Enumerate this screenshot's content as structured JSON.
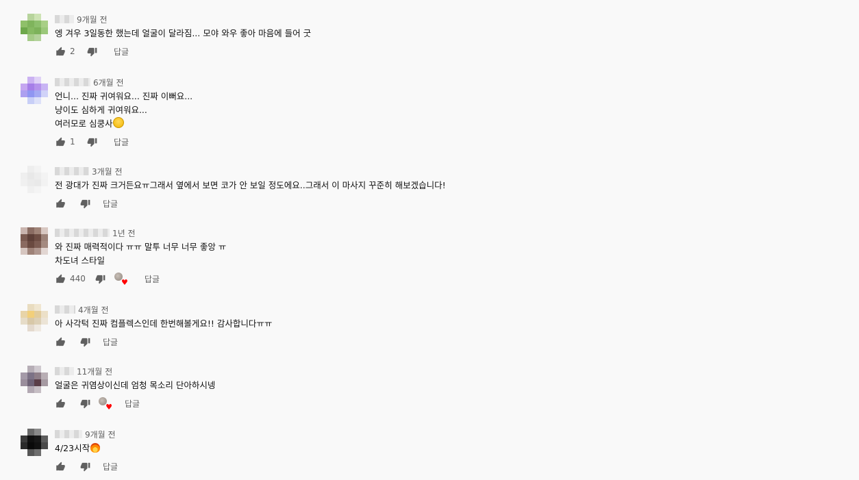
{
  "comments": [
    {
      "time": "9개월 전",
      "text": "엥 겨우 3일동한 했는데 얼굴이 달라짐... 모야 와우 좋아 마음에 들어 굿",
      "likes": "2",
      "reply": "답글",
      "avatar_colors": [
        "#f9f9f9",
        "#b7d49c",
        "#cde3b4",
        "#f9f9f9",
        "#8fc06a",
        "#7fb45c",
        "#8cbf6c",
        "#a8cf86",
        "#6ea84c",
        "#86ba62",
        "#7db25a",
        "#9bc87a",
        "#f9f9f9",
        "#a5cb87",
        "#b3d29a",
        "#f9f9f9"
      ]
    },
    {
      "time": "6개월 전",
      "text": "언니... 진짜 귀여워요... 진짜 이뻐요...\n냥이도 심하게 귀여워요...\n여러모로 심쿵사",
      "emoji": "smile-emoji",
      "likes": "1",
      "reply": "답글",
      "avatar_colors": [
        "#f9f9f9",
        "#cbb2f2",
        "#e0d2f7",
        "#f9f9f9",
        "#c5a6f0",
        "#a67ee8",
        "#b592ec",
        "#c8b4f4",
        "#ada0f0",
        "#8f96f2",
        "#a4a9f3",
        "#d0d2f8",
        "#f9f9f9",
        "#c8cff7",
        "#dde1f9",
        "#f9f9f9"
      ]
    },
    {
      "time": "3개월 전",
      "text": "전 광대가 진짜 크거든요ㅠ그래서 옆에서 보면 코가 안 보일 정도에요..그래서 이 마사지 꾸준히 해보겠습니다!",
      "likes": "",
      "reply": "답글",
      "avatar_colors": [
        "#f9f9f9",
        "#eeeeee",
        "#f3f3f3",
        "#f9f9f9",
        "#efefef",
        "#e8e8e8",
        "#ededed",
        "#f3f3f3",
        "#f0f0f0",
        "#ebebeb",
        "#e9e9e9",
        "#f2f2f2",
        "#f9f9f9",
        "#f0f0f0",
        "#f4f4f4",
        "#f9f9f9"
      ]
    },
    {
      "time": "1년 전",
      "text": "와 진짜 매력적이다 ㅠㅠ 말투 너무 너무 좋앙 ㅠ\n차도녀 스타일",
      "likes": "440",
      "hearted": true,
      "reply": "답글",
      "avatar_colors": [
        "#c9b4ae",
        "#8a6c62",
        "#a08478",
        "#d8c8c2",
        "#7a5a50",
        "#5e4038",
        "#6e4e44",
        "#9c8278",
        "#8a6a60",
        "#6a4a40",
        "#7c5c52",
        "#a48a80",
        "#d6c6c0",
        "#9e8278",
        "#b09890",
        "#e2d6d2"
      ]
    },
    {
      "time": "4개월 전",
      "text": "아 사각턱 진짜 컴플렉스인데 한번해볼게요!! 감사합니다ㅠㅠ",
      "likes": "",
      "reply": "답글",
      "avatar_colors": [
        "#f9f9f9",
        "#e9dcc0",
        "#f0e6d0",
        "#f9f9f9",
        "#e8d4a8",
        "#f2cf7a",
        "#e2cc9c",
        "#ece0c8",
        "#e6dcc8",
        "#d8c8a8",
        "#ddd0b6",
        "#ece4d6",
        "#f9f9f9",
        "#e4dace",
        "#efe9e0",
        "#f9f9f9"
      ]
    },
    {
      "time": "11개월 전",
      "text": "얼굴은 귀염상이신데 엄청 목소리 단아하시넹",
      "likes": "",
      "hearted": true,
      "reply": "답글",
      "avatar_colors": [
        "#f9f9f9",
        "#b6aeb6",
        "#cfc9cf",
        "#f9f9f9",
        "#a49aa8",
        "#7c7286",
        "#8e7e88",
        "#b8aeb4",
        "#9a8e9c",
        "#6e6276",
        "#5a3e48",
        "#a69aa2",
        "#f9f9f9",
        "#b2a8b2",
        "#c6bec4",
        "#f9f9f9"
      ]
    },
    {
      "time": "9개월 전",
      "text": "4/23시작",
      "emoji": "fire-emoji",
      "likes": "",
      "reply": "답글",
      "avatar_colors": [
        "#f9f9f9",
        "#6a6a6a",
        "#8a8a8a",
        "#f9f9f9",
        "#3a3a3a",
        "#101010",
        "#181818",
        "#5c5c5c",
        "#2a2a2a",
        "#0a0a0a",
        "#121212",
        "#4a4a4a",
        "#f9f9f9",
        "#565656",
        "#6e6e6e",
        "#f9f9f9"
      ]
    }
  ]
}
